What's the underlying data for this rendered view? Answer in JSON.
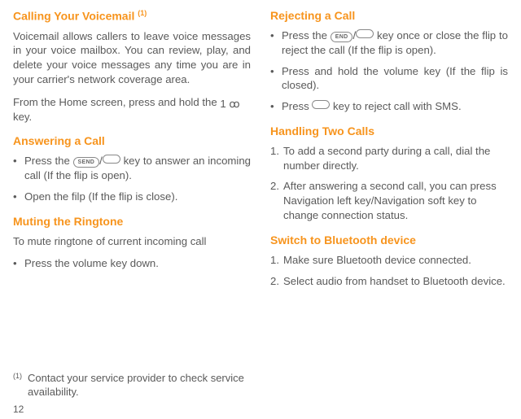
{
  "left": {
    "h1": "Calling Your Voicemail ",
    "h1_sup": "(1)",
    "p1": "Voicemail allows callers to leave voice mes­sages in your voice mailbox. You can review, play, and delete your voice messages any time you are in your carrier's network coverage area.",
    "p2a": "From the Home screen, press and hold the ",
    "p2b": " key.",
    "h2": "Answering a Call",
    "b1a": "Press the ",
    "b1b": " key to answer an incoming call (If the flip is open).",
    "b2": "Open the filp (If the flip is close).",
    "h3": "Muting the Ringtone",
    "p3": "To mute ringtone of current incoming call",
    "b3": "Press the volume key down.",
    "key_send": "SEND",
    "key_vm": "1 ꝏ"
  },
  "right": {
    "h1": "Rejecting a Call",
    "b1a": "Press the ",
    "b1b": " key once or close the flip to reject the call (If the flip is open).",
    "b2": "Press and hold the volume key (If the flip is closed).",
    "b3a": "Press ",
    "b3b": " key to reject call with SMS.",
    "key_end": "END",
    "h2": "Handling Two Calls",
    "n1": "To add a second party during a call, dial the number directly.",
    "n2": "After answering a second call, you can press Navigation left key/Navigation soft key to change connection status.",
    "h3": "Switch to Bluetooth device",
    "n3": "Make sure Bluetooth device connected.",
    "n4": "Select audio from handset to Bluetooth device."
  },
  "footnote": {
    "mark": "(1)",
    "text": "Contact your service provider to check service availability."
  },
  "page": "12"
}
